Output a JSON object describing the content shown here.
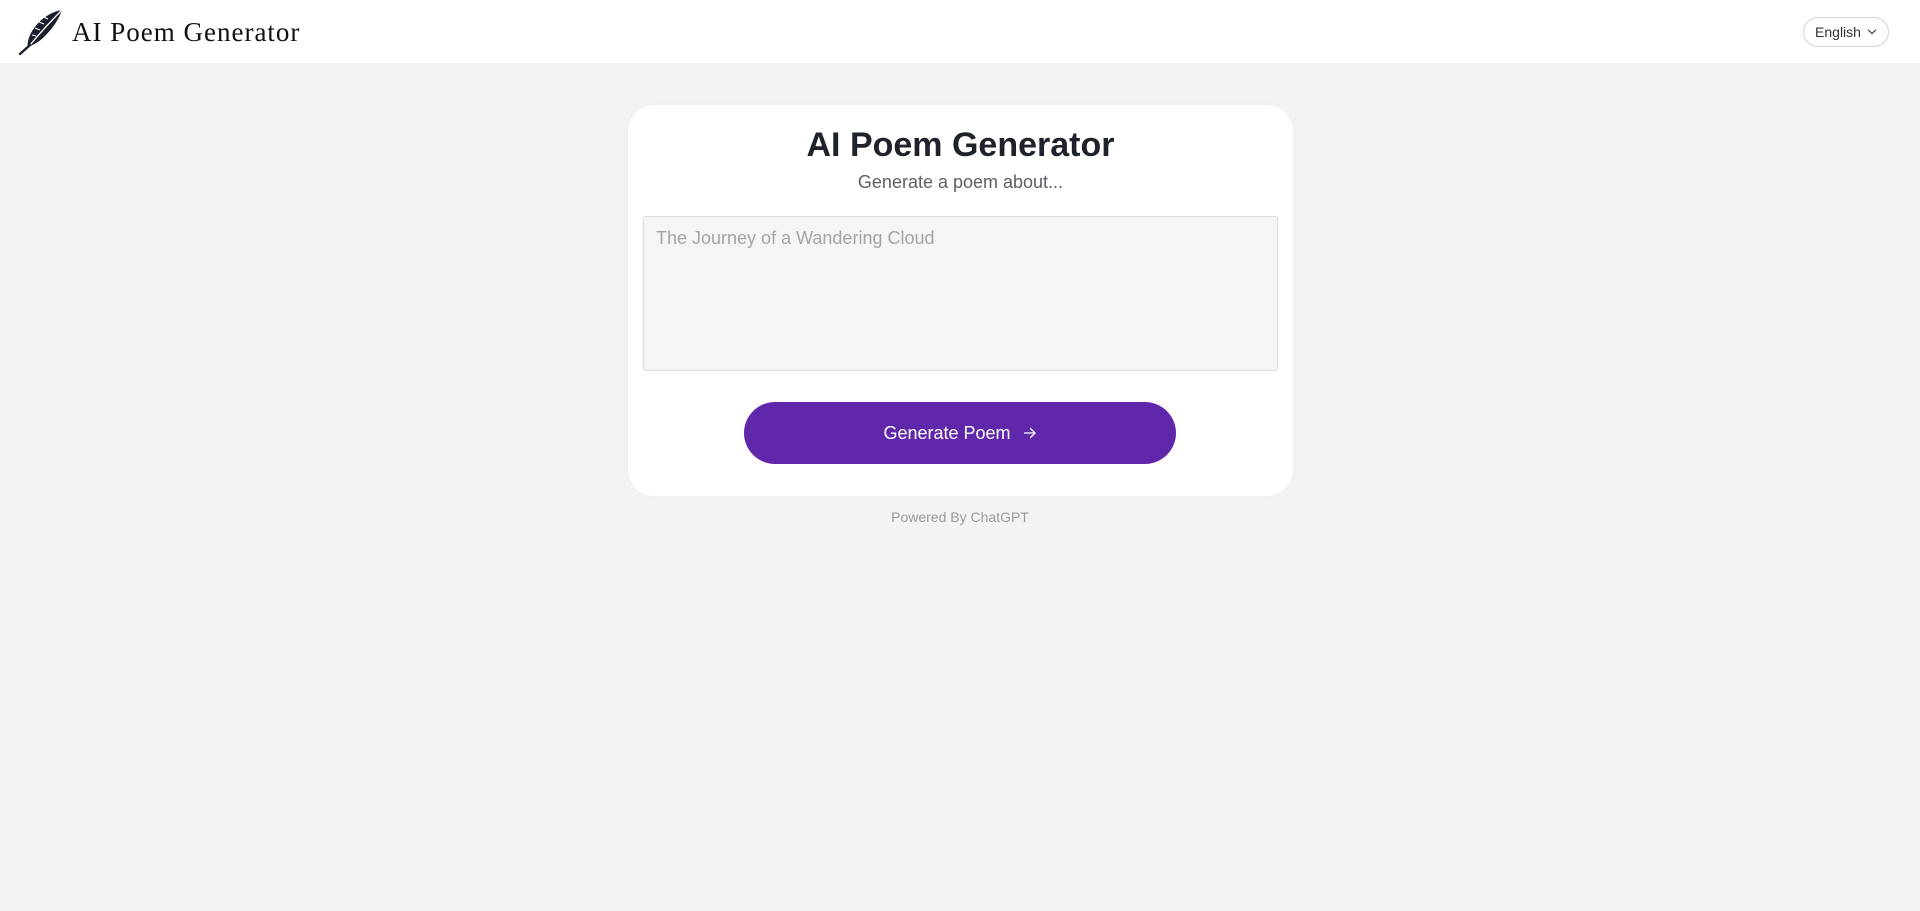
{
  "header": {
    "brand_text": "AI Poem Generator",
    "logo_icon": "feather-quill-icon",
    "language_selected": "English",
    "language_chevron_icon": "chevron-down-icon"
  },
  "card": {
    "title": "AI Poem Generator",
    "subtitle": "Generate a poem about...",
    "prompt_value": "",
    "prompt_placeholder": "The Journey of a Wandering Cloud",
    "generate_label": "Generate Poem",
    "generate_icon": "arrow-right-icon"
  },
  "footer": {
    "powered_by": "Powered By ChatGPT"
  },
  "colors": {
    "background": "#f3f3f2",
    "card": "#ffffff",
    "accent": "#6127ab",
    "title_text": "#1e222a",
    "muted_text": "#9a9a9a"
  }
}
